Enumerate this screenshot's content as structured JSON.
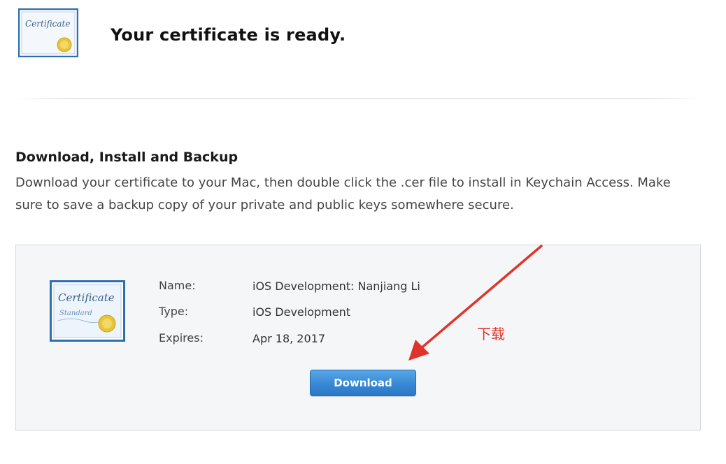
{
  "header": {
    "title": "Your certificate is ready.",
    "icon": "certificate-icon",
    "icon_text": "Certificate"
  },
  "section": {
    "title": "Download, Install and Backup",
    "description": "Download your certificate to your Mac, then double click the .cer file to install in Keychain Access. Make sure to save a backup copy of your private and public keys somewhere secure."
  },
  "certificate": {
    "icon": "certificate-standard-icon",
    "icon_text": "Certificate",
    "icon_subtext": "Standard",
    "name_label": "Name:",
    "name_value": "iOS Development: Nanjiang Li",
    "type_label": "Type:",
    "type_value": "iOS Development",
    "expires_label": "Expires:",
    "expires_value": "Apr 18, 2017",
    "download_label": "Download"
  },
  "annotation": {
    "text": "下载",
    "color": "#e0342b"
  },
  "colors": {
    "button": "#3a8ad6",
    "cert_border": "#2f6fb0",
    "seal": "#e8c43a"
  }
}
